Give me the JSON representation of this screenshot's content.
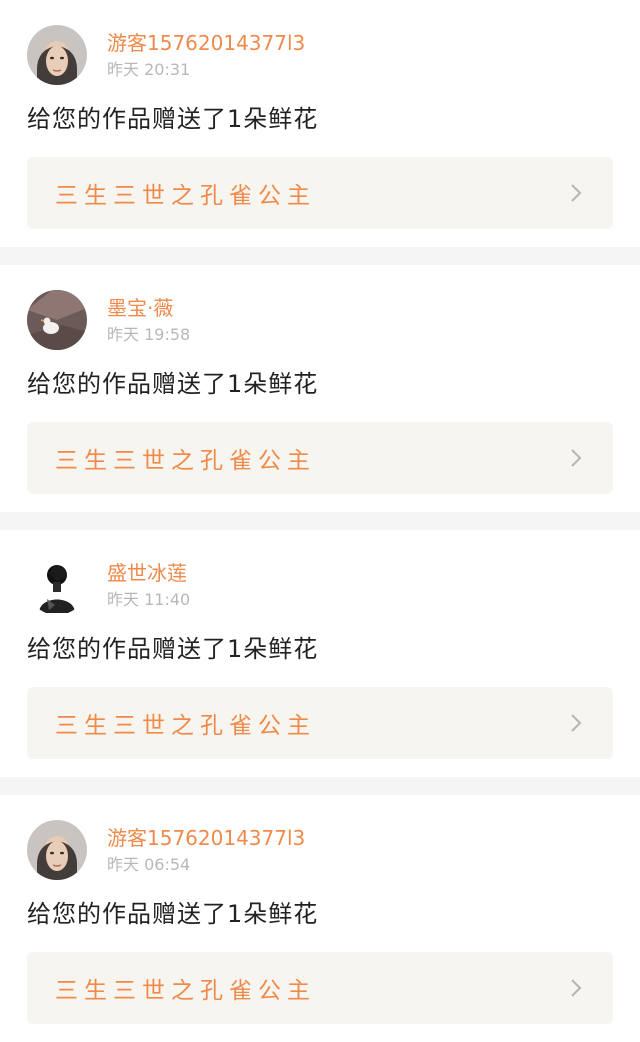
{
  "notifications": [
    {
      "avatar": "woman-portrait-avatar",
      "user": "游客15762014377l3",
      "time": "昨天 20:31",
      "message": "给您的作品赠送了1朵鲜花",
      "work_title": "三生三世之孔雀公主"
    },
    {
      "avatar": "white-bird-avatar",
      "user": "墨宝·薇",
      "time": "昨天 19:58",
      "message": "给您的作品赠送了1朵鲜花",
      "work_title": "三生三世之孔雀公主"
    },
    {
      "avatar": "dark-figure-avatar",
      "user": "盛世冰莲",
      "time": "昨天 11:40",
      "message": "给您的作品赠送了1朵鲜花",
      "work_title": "三生三世之孔雀公主"
    },
    {
      "avatar": "woman-portrait-avatar",
      "user": "游客15762014377l3",
      "time": "昨天 06:54",
      "message": "给您的作品赠送了1朵鲜花",
      "work_title": "三生三世之孔雀公主"
    }
  ],
  "colors": {
    "accent": "#f08a4b",
    "card_bg": "#f6f5ef",
    "page_bg": "#f5f5f5",
    "time": "#b8b8b8"
  }
}
